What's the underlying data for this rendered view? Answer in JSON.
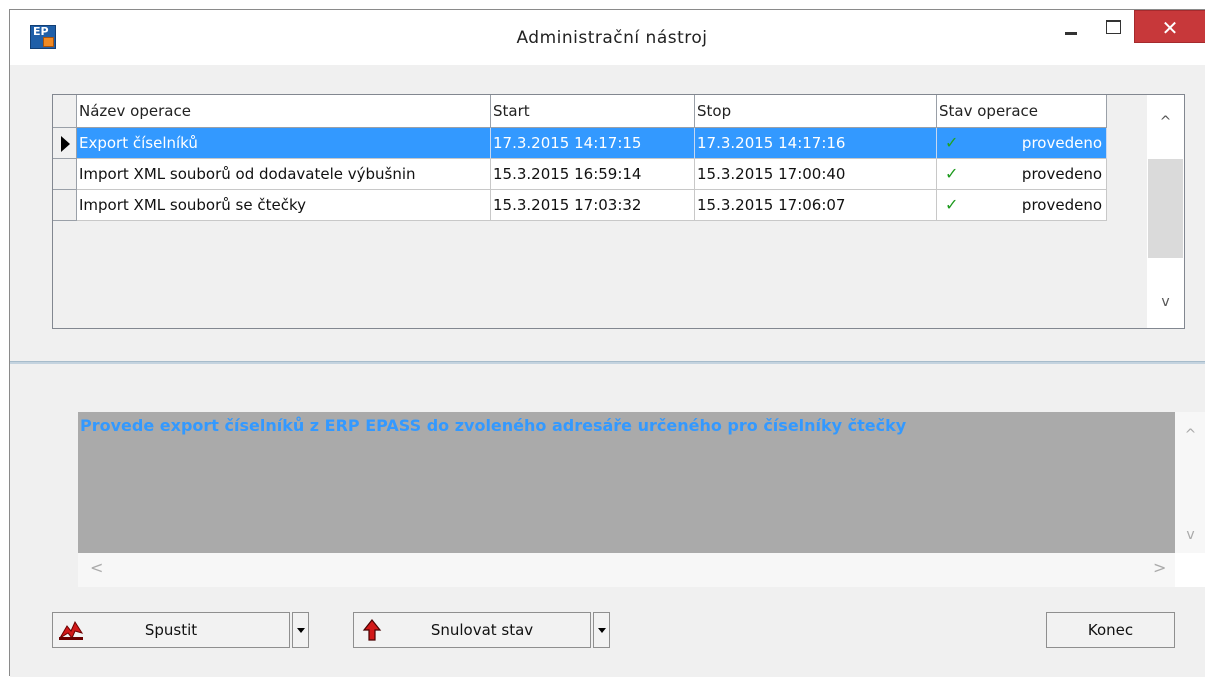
{
  "window": {
    "title": "Administrační nástroj",
    "close_glyph": "✕"
  },
  "grid": {
    "columns": [
      "Název operace",
      "Start",
      "Stop",
      "Stav operace"
    ],
    "rows": [
      {
        "name": "Export číselníků",
        "start": "17.3.2015 14:17:15",
        "stop": "17.3.2015 14:17:16",
        "status": "provedeno",
        "selected": true
      },
      {
        "name": "Import XML souborů od dodavatele výbušnin",
        "start": "15.3.2015 16:59:14",
        "stop": "15.3.2015 17:00:40",
        "status": "provedeno",
        "selected": false
      },
      {
        "name": "Import XML souborů se čtečky",
        "start": "15.3.2015 17:03:32",
        "stop": "15.3.2015 17:06:07",
        "status": "provedeno",
        "selected": false
      }
    ],
    "status_icon": "check-icon",
    "scroll_up": "^",
    "scroll_down": "v"
  },
  "description": {
    "text": "Provede export číselníků z ERP EPASS do zvoleného adresáře určeného pro číselníky čtečky",
    "scroll_up": "^",
    "scroll_down": "v",
    "scroll_left": "<",
    "scroll_right": ">"
  },
  "buttons": {
    "run": "Spustit",
    "reset": "Snulovat stav",
    "close": "Konec"
  },
  "colors": {
    "selection": "#3399ff",
    "description_text": "#3399ff",
    "close_button": "#c7383a"
  }
}
